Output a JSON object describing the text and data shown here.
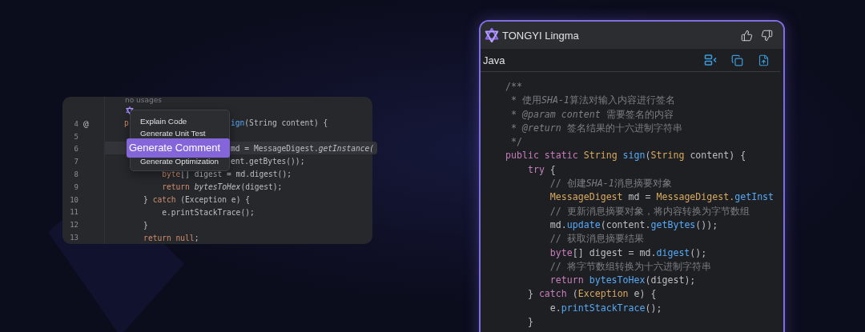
{
  "editor": {
    "hint": "no usages",
    "lines": [
      {
        "number": "4",
        "marker": "@",
        "highlighted": false,
        "before": [
          {
            "text": "p",
            "kind": "kw2"
          }
        ],
        "after": [
          {
            "text": "ign",
            "kind": "method"
          },
          {
            "text": "(String content) {",
            "kind": "plain"
          }
        ]
      },
      {
        "number": "5",
        "highlighted": false
      },
      {
        "number": "6",
        "highlighted": true,
        "after": [
          {
            "text": "md = MessageDigest.",
            "kind": "plain"
          },
          {
            "text": "getInstance(",
            "kind": "italic"
          }
        ]
      },
      {
        "number": "7",
        "highlighted": false,
        "after": [
          {
            "text": "ent.getBytes());",
            "kind": "plain"
          }
        ]
      },
      {
        "number": "8",
        "highlighted": false,
        "tokens": [
          {
            "text": "        byte",
            "kind": "kw2"
          },
          {
            "text": "[] digest = md.digest();",
            "kind": "plain"
          }
        ]
      },
      {
        "number": "9",
        "highlighted": false,
        "tokens": [
          {
            "text": "        return ",
            "kind": "kw2"
          },
          {
            "text": "bytesToHex",
            "kind": "italic"
          },
          {
            "text": "(digest);",
            "kind": "plain"
          }
        ]
      },
      {
        "number": "10",
        "highlighted": false,
        "tokens": [
          {
            "text": "    } ",
            "kind": "plain"
          },
          {
            "text": "catch",
            "kind": "kw2"
          },
          {
            "text": " (Exception e) {",
            "kind": "plain"
          }
        ]
      },
      {
        "number": "11",
        "highlighted": false,
        "tokens": [
          {
            "text": "        e.printStackTrace();",
            "kind": "plain"
          }
        ]
      },
      {
        "number": "12",
        "highlighted": false,
        "tokens": [
          {
            "text": "    }",
            "kind": "plain"
          }
        ]
      },
      {
        "number": "13",
        "highlighted": false,
        "tokens": [
          {
            "text": "    return null",
            "kind": "kw2"
          },
          {
            "text": ";",
            "kind": "plain"
          }
        ]
      }
    ],
    "context_menu": {
      "items": [
        {
          "label": "Explain Code",
          "selected": false
        },
        {
          "label": "Generate Unit Test",
          "selected": false
        },
        {
          "label": "Generate Comment",
          "selected": true
        },
        {
          "label": "Generate Optimization",
          "selected": false
        }
      ]
    }
  },
  "assistant": {
    "title": "TONGYI Lingma",
    "language": "Java",
    "code": [
      [
        {
          "text": "/**",
          "kind": "comment"
        }
      ],
      [
        {
          "text": " * 使用",
          "kind": "comment"
        },
        {
          "text": "SHA-1",
          "kind": "doc"
        },
        {
          "text": "算法对输入内容进行签名",
          "kind": "comment"
        }
      ],
      [
        {
          "text": " * ",
          "kind": "comment"
        },
        {
          "text": "@param content",
          "kind": "doc"
        },
        {
          "text": " 需要签名的内容",
          "kind": "comment"
        }
      ],
      [
        {
          "text": " * ",
          "kind": "comment"
        },
        {
          "text": "@return",
          "kind": "doc"
        },
        {
          "text": " 签名结果的十六进制字符串",
          "kind": "comment"
        }
      ],
      [
        {
          "text": " */",
          "kind": "comment"
        }
      ],
      [
        {
          "text": "public static ",
          "kind": "kw"
        },
        {
          "text": "String ",
          "kind": "type"
        },
        {
          "text": "sign",
          "kind": "method"
        },
        {
          "text": "(",
          "kind": "plain"
        },
        {
          "text": "String",
          "kind": "type"
        },
        {
          "text": " content) {",
          "kind": "plain"
        }
      ],
      [
        {
          "text": "    try",
          "kind": "kw"
        },
        {
          "text": " {",
          "kind": "plain"
        }
      ],
      [
        {
          "text": "        // 创建",
          "kind": "comment"
        },
        {
          "text": "SHA-1",
          "kind": "doc"
        },
        {
          "text": "消息摘要对象",
          "kind": "comment"
        }
      ],
      [
        {
          "text": "        MessageDigest",
          "kind": "type"
        },
        {
          "text": " md = ",
          "kind": "plain"
        },
        {
          "text": "MessageDigest.",
          "kind": "type"
        },
        {
          "text": "getInst",
          "kind": "method"
        }
      ],
      [
        {
          "text": "        // 更新消息摘要对象，将内容转换为字节数组",
          "kind": "comment"
        }
      ],
      [
        {
          "text": "        md.",
          "kind": "plain"
        },
        {
          "text": "update",
          "kind": "method"
        },
        {
          "text": "(content.",
          "kind": "plain"
        },
        {
          "text": "getBytes",
          "kind": "method"
        },
        {
          "text": "());",
          "kind": "plain"
        }
      ],
      [
        {
          "text": "        // 获取消息摘要结果",
          "kind": "comment"
        }
      ],
      [
        {
          "text": "        byte",
          "kind": "kw"
        },
        {
          "text": "[] digest = md.",
          "kind": "plain"
        },
        {
          "text": "digest",
          "kind": "method"
        },
        {
          "text": "();",
          "kind": "plain"
        }
      ],
      [
        {
          "text": "        // 将字节数组转换为十六进制字符串",
          "kind": "comment"
        }
      ],
      [
        {
          "text": "        return ",
          "kind": "kw"
        },
        {
          "text": "bytesToHex",
          "kind": "method"
        },
        {
          "text": "(digest);",
          "kind": "plain"
        }
      ],
      [
        {
          "text": "    } ",
          "kind": "plain"
        },
        {
          "text": "catch",
          "kind": "kw"
        },
        {
          "text": " (",
          "kind": "plain"
        },
        {
          "text": "Exception",
          "kind": "type"
        },
        {
          "text": " e) {",
          "kind": "plain"
        }
      ],
      [
        {
          "text": "        e.",
          "kind": "plain"
        },
        {
          "text": "printStackTrace",
          "kind": "method"
        },
        {
          "text": "();",
          "kind": "plain"
        }
      ],
      [
        {
          "text": "    }",
          "kind": "plain"
        }
      ]
    ]
  }
}
